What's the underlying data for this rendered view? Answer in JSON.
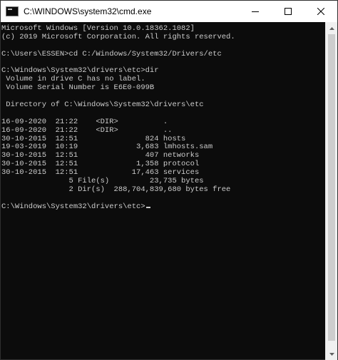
{
  "window": {
    "title": "C:\\WINDOWS\\system32\\cmd.exe",
    "background_color": "#0c0c0c",
    "text_color": "#cccccc",
    "app_icon": "cmd-icon",
    "controls": {
      "minimize_icon": "minimize-icon",
      "maximize_icon": "maximize-icon",
      "close_icon": "close-icon"
    }
  },
  "console": {
    "lines": [
      "Microsoft Windows [Version 10.0.18362.1082]",
      "(c) 2019 Microsoft Corporation. All rights reserved.",
      "",
      "C:\\Users\\ESSEN>cd C:/Windows/System32/Drivers/etc",
      "",
      "C:\\Windows\\System32\\drivers\\etc>dir",
      " Volume in drive C has no label.",
      " Volume Serial Number is E6E0-099B",
      "",
      " Directory of C:\\Windows\\System32\\drivers\\etc",
      "",
      "16-09-2020  21:22    <DIR>          .",
      "16-09-2020  21:22    <DIR>          ..",
      "30-10-2015  12:51               824 hosts",
      "19-03-2019  10:19             3,683 lmhosts.sam",
      "30-10-2015  12:51               407 networks",
      "30-10-2015  12:51             1,358 protocol",
      "30-10-2015  12:51            17,463 services",
      "               5 File(s)         23,735 bytes",
      "               2 Dir(s)  288,704,839,680 bytes free",
      "",
      "C:\\Windows\\System32\\drivers\\etc>"
    ]
  },
  "scrollbar": {
    "up_icon": "scroll-up-arrow-icon",
    "down_icon": "scroll-down-arrow-icon"
  }
}
